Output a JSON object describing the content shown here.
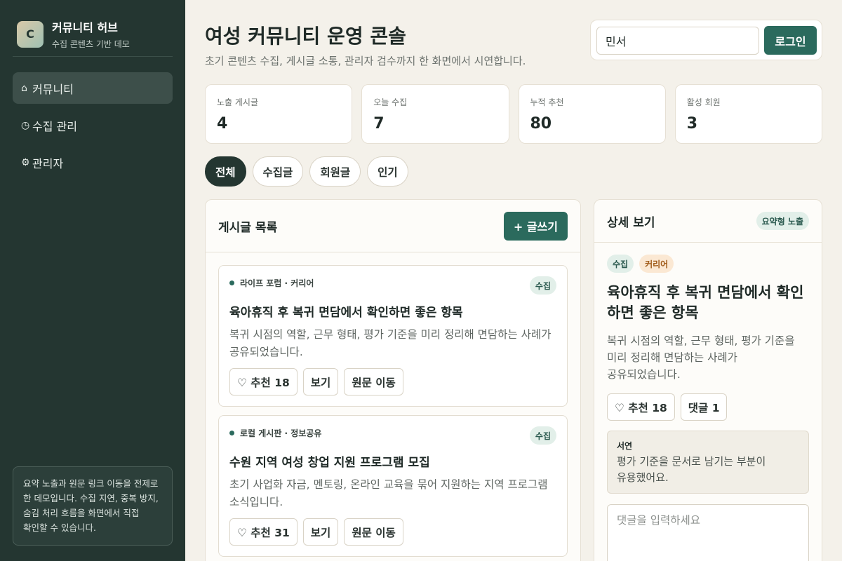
{
  "sidebar": {
    "logo_letter": "C",
    "title": "커뮤니티 허브",
    "subtitle": "수집 콘텐츠 기반 데모",
    "items": [
      {
        "icon": "⌂",
        "label": "커뮤니티"
      },
      {
        "icon": "◷",
        "label": "수집 관리"
      },
      {
        "icon": "⚙",
        "label": "관리자"
      }
    ],
    "note": "요약 노출과 원문 링크 이동을 전제로 한 데모입니다. 수집 지연, 중복 방지, 숨김 처리 흐름을 화면에서 직접 확인할 수 있습니다."
  },
  "header": {
    "title": "여성 커뮤니티 운영 콘솔",
    "subtitle": "초기 콘텐츠 수집, 게시글 소통, 관리자 검수까지 한 화면에서 시연합니다.",
    "login_value": "민서",
    "login_button": "로그인"
  },
  "stats": [
    {
      "label": "노출 게시글",
      "value": "4"
    },
    {
      "label": "오늘 수집",
      "value": "7"
    },
    {
      "label": "누적 추천",
      "value": "80"
    },
    {
      "label": "활성 회원",
      "value": "3"
    }
  ],
  "filters": [
    "전체",
    "수집글",
    "회원글",
    "인기"
  ],
  "list": {
    "title": "게시글 목록",
    "write_button": "+ 글쓰기",
    "posts": [
      {
        "meta": "라이프 포럼 · 커리어",
        "tag": "수집",
        "title": "육아휴직 후 복귀 면담에서 확인하면 좋은 항목",
        "desc": "복귀 시점의 역할, 근무 형태, 평가 기준을 미리 정리해 면담하는 사례가 공유되었습니다.",
        "like": "♡ 추천 18",
        "view": "보기",
        "origin": "원문 이동"
      },
      {
        "meta": "로컬 게시판 · 정보공유",
        "tag": "수집",
        "title": "수원 지역 여성 창업 지원 프로그램 모집",
        "desc": "초기 사업화 자금, 멘토링, 온라인 교육을 묶어 지원하는 지역 프로그램 소식입니다.",
        "like": "♡ 추천 31",
        "view": "보기",
        "origin": "원문 이동"
      }
    ]
  },
  "detail": {
    "title": "상세 보기",
    "mode": "요약형 노출",
    "tag1": "수집",
    "tag2": "커리어",
    "post_title": "육아휴직 후 복귀 면담에서 확인하면 좋은 항목",
    "desc": "복귀 시점의 역할, 근무 형태, 평가 기준을 미리 정리해 면담하는 사례가 공유되었습니다.",
    "like": "♡ 추천 18",
    "comments": "댓글 1",
    "comment_author": "서연",
    "comment_text": "평가 기준을 문서로 남기는 부분이 유용했어요.",
    "comment_placeholder": "댓글을 입력하세요"
  }
}
